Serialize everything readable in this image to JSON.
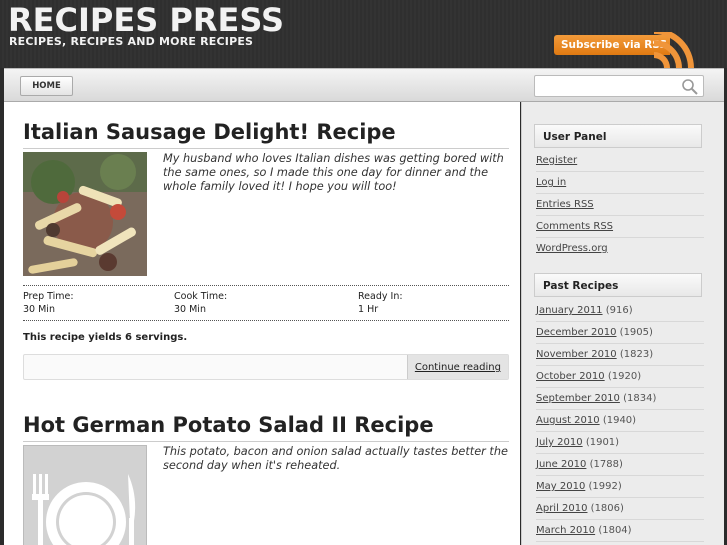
{
  "site": {
    "title": "RECIPES PRESS",
    "tagline": "RECIPES, RECIPES AND MORE RECIPES",
    "subscribe_label": "Subscribe via RSS"
  },
  "nav": {
    "home_label": "HOME",
    "search_placeholder": ""
  },
  "posts": [
    {
      "title": "Italian Sausage Delight! Recipe",
      "excerpt": "My husband who loves Italian dishes was getting bored with the same ones, so I made this one day for dinner and the whole family loved it! I hope you will too!",
      "prep_label": "Prep Time:",
      "prep_value": "30 Min",
      "cook_label": "Cook Time:",
      "cook_value": "30 Min",
      "ready_label": "Ready In:",
      "ready_value": "1 Hr",
      "yields": "This recipe yields 6 servings.",
      "continue_label": "Continue reading"
    },
    {
      "title": "Hot German Potato Salad II Recipe",
      "excerpt": "This potato, bacon and onion salad actually tastes better the second day when it's reheated."
    }
  ],
  "sidebar": {
    "user_panel": {
      "title": "User Panel",
      "links": [
        "Register",
        "Log in",
        "Entries RSS",
        "Comments RSS",
        "WordPress.org"
      ]
    },
    "past_recipes": {
      "title": "Past Recipes",
      "items": [
        {
          "label": "January 2011",
          "count": "(916)"
        },
        {
          "label": "December 2010",
          "count": "(1905)"
        },
        {
          "label": "November 2010",
          "count": "(1823)"
        },
        {
          "label": "October 2010",
          "count": "(1920)"
        },
        {
          "label": "September 2010",
          "count": "(1834)"
        },
        {
          "label": "August 2010",
          "count": "(1940)"
        },
        {
          "label": "July 2010",
          "count": "(1901)"
        },
        {
          "label": "June 2010",
          "count": "(1788)"
        },
        {
          "label": "May 2010",
          "count": "(1992)"
        },
        {
          "label": "April 2010",
          "count": "(1806)"
        },
        {
          "label": "March 2010",
          "count": "(1804)"
        }
      ]
    }
  },
  "colors": {
    "header_bg": "#2f2f2f",
    "rss_orange": "#e98a24",
    "sidebar_bg": "#ececec"
  }
}
